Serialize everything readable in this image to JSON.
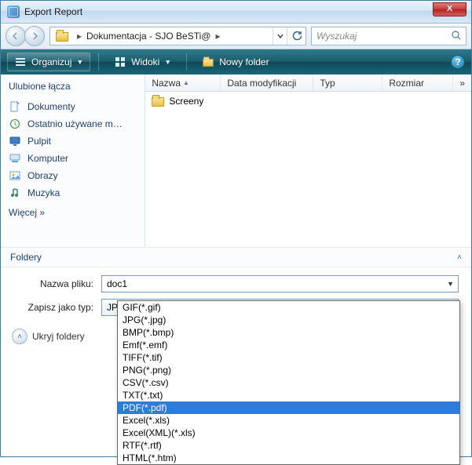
{
  "window": {
    "title": "Export Report"
  },
  "address": {
    "path": "Dokumentacja - SJO BeSTi@",
    "crumb_sep1": "▸",
    "crumb_sep2": "▸"
  },
  "search": {
    "placeholder": "Wyszukaj"
  },
  "toolbar": {
    "organize": "Organizuj",
    "views": "Widoki",
    "newfolder": "Nowy folder"
  },
  "sidebar": {
    "header": "Ulubione łącza",
    "items": [
      {
        "label": "Dokumenty"
      },
      {
        "label": "Ostatnio używane m…"
      },
      {
        "label": "Pulpit"
      },
      {
        "label": "Komputer"
      },
      {
        "label": "Obrazy"
      },
      {
        "label": "Muzyka"
      }
    ],
    "more": "Więcej »"
  },
  "columns": {
    "name": "Nazwa",
    "date": "Data modyfikacji",
    "type": "Typ",
    "size": "Rozmiar",
    "more": "»"
  },
  "files": [
    {
      "name": "Screeny"
    }
  ],
  "folders_toggle": "Foldery",
  "form": {
    "filename_label": "Nazwa pliku:",
    "filename_value": "doc1",
    "type_label": "Zapisz jako typ:",
    "type_value": "JPG(*.jpg)"
  },
  "hide_folders": "Ukryj foldery",
  "type_options": [
    "GIF(*.gif)",
    "JPG(*.jpg)",
    "BMP(*.bmp)",
    "Emf(*.emf)",
    "TIFF(*.tif)",
    "PNG(*.png)",
    "CSV(*.csv)",
    "TXT(*.txt)",
    "PDF(*.pdf)",
    "Excel(*.xls)",
    "Excel(XML)(*.xls)",
    "RTF(*.rtf)",
    "HTML(*.htm)"
  ],
  "type_selected_index": 8
}
